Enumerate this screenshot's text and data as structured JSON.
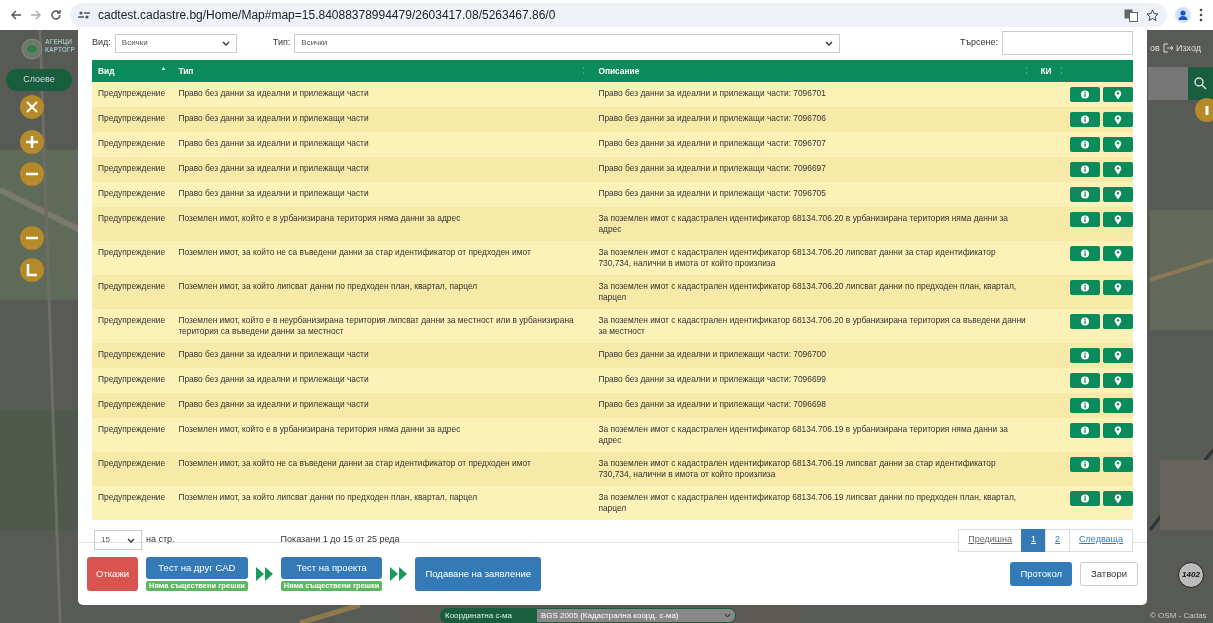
{
  "browser": {
    "url": "cadtest.cadastre.bg/Home/Map#map=15.84088378994479/2603417.08/5263467.86/0"
  },
  "map": {
    "logo_lines": [
      "АГЕНЦИ",
      "КАРТОГР"
    ],
    "layers_button": "Слоеве",
    "partial_link": "ов",
    "exit_link": "Изход",
    "marker": "1402",
    "coord_label": "Координатна с-ма",
    "coord_value": "BGS 2005 (Кадастрална коорд. с-ма)",
    "attribution": "© OSM - Cadas"
  },
  "filters": {
    "vid_label": "Вид:",
    "vid_value": "Всички",
    "tip_label": "Тип:",
    "tip_value": "Всички",
    "search_label": "Търсене:"
  },
  "table": {
    "columns": [
      "Вид",
      "Тип",
      "Описание",
      "КИ"
    ],
    "rows": [
      {
        "vid": "Предупреждение",
        "tip": "Право без данни за идеални и прилежащи части",
        "opisanie": "Право без данни за идеални и прилежащи части: 7096701"
      },
      {
        "vid": "Предупреждение",
        "tip": "Право без данни за идеални и прилежащи части",
        "opisanie": "Право без данни за идеални и прилежащи части: 7096706"
      },
      {
        "vid": "Предупреждение",
        "tip": "Право без данни за идеални и прилежащи части",
        "opisanie": "Право без данни за идеални и прилежащи части: 7096707"
      },
      {
        "vid": "Предупреждение",
        "tip": "Право без данни за идеални и прилежащи части",
        "opisanie": "Право без данни за идеални и прилежащи части: 7096697"
      },
      {
        "vid": "Предупреждение",
        "tip": "Право без данни за идеални и прилежащи части",
        "opisanie": "Право без данни за идеални и прилежащи части: 7096705"
      },
      {
        "vid": "Предупреждение",
        "tip": "Поземлен имот, който е в урбанизирана територия няма данни за адрес",
        "opisanie": "За поземлен имот с кадастрален идентификатор 68134.706.20 в урбанизирана територия няма данни за адрес"
      },
      {
        "vid": "Предупреждение",
        "tip": "Поземлен имот, за който не са въведени данни за стар идентификатор от предходен имот",
        "opisanie": "За поземлен имот с кадастрален идентификатор 68134.706.20 липсват данни за стар идентификатор 730,734, налични в имота от който произлиза"
      },
      {
        "vid": "Предупреждение",
        "tip": "Поземлен имот, за който липсват данни по предходен план, квартал, парцел",
        "opisanie": "За поземлен имот с кадастрален идентификатор 68134.706.20 липсват данни по предходен план, квартал, парцел"
      },
      {
        "vid": "Предупреждение",
        "tip": "Поземлен имот, който е в неурбанизирана територия липсват данни за местност или в урбанизирана територия са въведени данни за местност",
        "opisanie": "За поземлен имот с кадастрален идентификатор 68134.706.20 в урбанизирана територия са въведени данни за местност"
      },
      {
        "vid": "Предупреждение",
        "tip": "Право без данни за идеални и прилежащи части",
        "opisanie": "Право без данни за идеални и прилежащи части: 7096700"
      },
      {
        "vid": "Предупреждение",
        "tip": "Право без данни за идеални и прилежащи части",
        "opisanie": "Право без данни за идеални и прилежащи части: 7096699"
      },
      {
        "vid": "Предупреждение",
        "tip": "Право без данни за идеални и прилежащи части",
        "opisanie": "Право без данни за идеални и прилежащи части: 7096698"
      },
      {
        "vid": "Предупреждение",
        "tip": "Поземлен имот, който е в урбанизирана територия няма данни за адрес",
        "opisanie": "За поземлен имот с кадастрален идентификатор 68134.706.19 в урбанизирана територия няма данни за адрес"
      },
      {
        "vid": "Предупреждение",
        "tip": "Поземлен имот, за който не са въведени данни за стар идентификатор от предходен имот",
        "opisanie": "За поземлен имот с кадастрален идентификатор 68134.706.19 липсват данни за стар идентификатор 730,734, налични в имота от който произлиза"
      },
      {
        "vid": "Предупреждение",
        "tip": "Поземлен имот, за който липсват данни по предходен план, квартал, парцел",
        "opisanie": "За поземлен имот с кадастрален идентификатор 68134.706.19 липсват данни по предходен план, квартал, парцел"
      }
    ]
  },
  "pagination": {
    "page_size": "15",
    "page_size_label": "на стр.",
    "summary": "Показани 1 до 15 от 25 реда",
    "pages": [
      {
        "label": "Предишна",
        "selected": false
      },
      {
        "label": "1",
        "selected": true
      },
      {
        "label": "2",
        "selected": false
      },
      {
        "label": "Следваща",
        "selected": false
      }
    ]
  },
  "footer": {
    "cancel": "Откажи",
    "steps": [
      {
        "label": "Тест на друг CAD",
        "badge": "Няма съществени грешки"
      },
      {
        "label": "Тест на проекта",
        "badge": "Няма съществени грешки"
      },
      {
        "label": "Подаване на заявление"
      }
    ],
    "protocol": "Протокол",
    "close": "Затвори"
  }
}
